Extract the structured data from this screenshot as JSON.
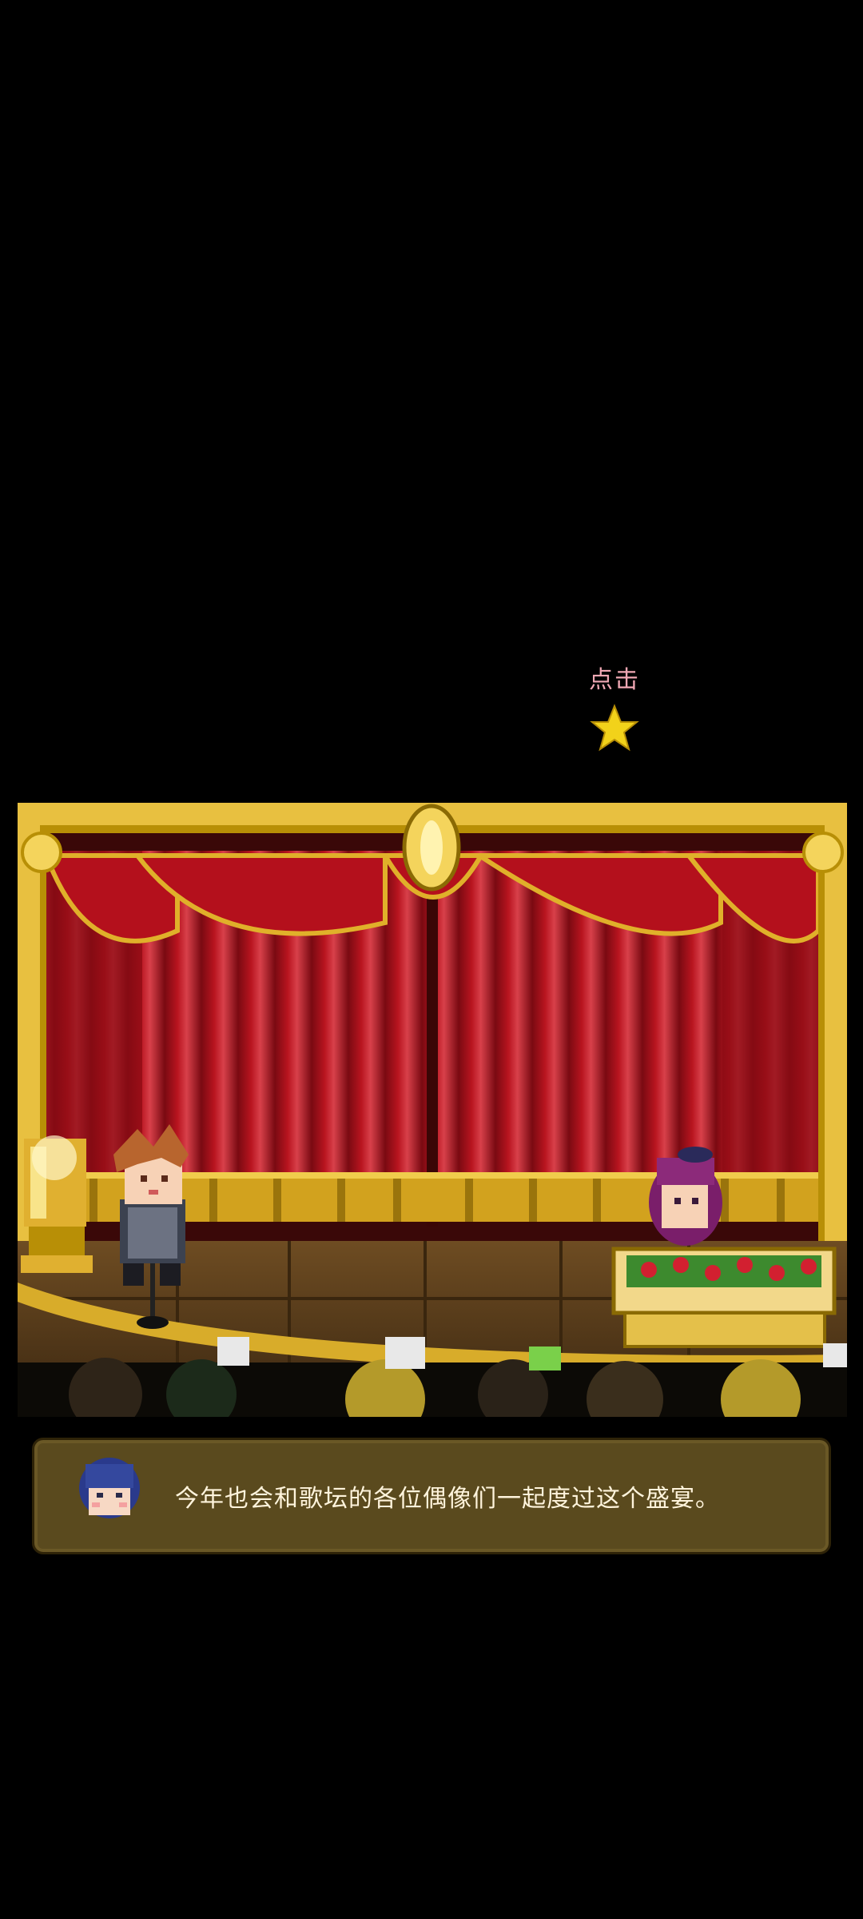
{
  "hint": {
    "label": "点击",
    "icon": "star-icon",
    "color_label": "#f0a8b4",
    "color_star": "#f2d21a"
  },
  "scene": {
    "curtain_color": "#a0101a",
    "frame_color": "#e8c040",
    "characters": [
      "host-boy-character",
      "purple-hair-girl-character"
    ],
    "props": [
      "golden-trophy",
      "microphone-stand",
      "flower-table",
      "audience-silhouettes"
    ]
  },
  "dialog": {
    "speaker_icon": "blue-hair-avatar",
    "text": "今年也会和歌坛的各位偶像们一起度过这个盛宴。",
    "box_color": "#5a4a1e",
    "text_color": "#fff4dc"
  }
}
